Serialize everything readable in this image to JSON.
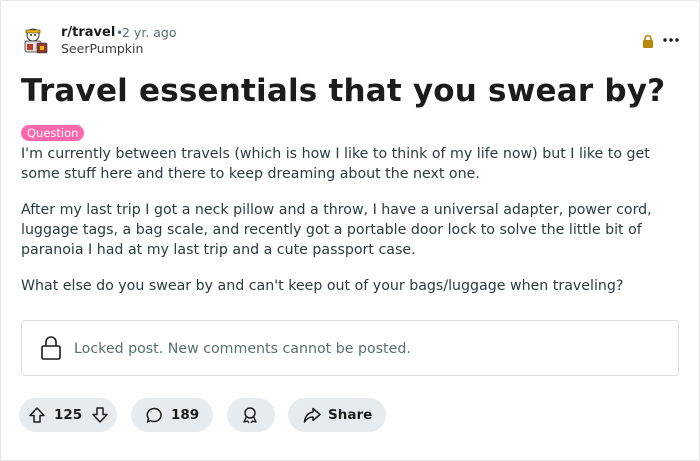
{
  "post": {
    "subreddit": "r/travel",
    "separator": "•",
    "age": "2 yr. ago",
    "author": "SeerPumpkin",
    "title": "Travel essentials that you swear by?",
    "flair": "Question",
    "flair_color": "#ff66ac",
    "body": [
      "I'm currently between travels (which is how I like to think of my life now) but I like to get some stuff here and there to keep dreaming about the next one.",
      "After my last trip I got a neck pillow and a throw, I have a universal adapter, power cord, luggage tags, a bag scale, and recently got a portable door lock to solve the little bit of paranoia I had at my last trip and a cute passport case.",
      "What else do you swear by and can't keep out of your bags/luggage when traveling?"
    ]
  },
  "locked_notice": "Locked post. New comments cannot be posted.",
  "actions": {
    "upvotes": "125",
    "comments": "189",
    "share_label": "Share"
  },
  "colors": {
    "lock_accent": "#b8860b",
    "pill_bg": "#e5ebee"
  },
  "icons": [
    "avatar",
    "lock-icon",
    "more-options-icon",
    "upvote-icon",
    "downvote-icon",
    "comment-icon",
    "award-icon",
    "share-icon"
  ]
}
